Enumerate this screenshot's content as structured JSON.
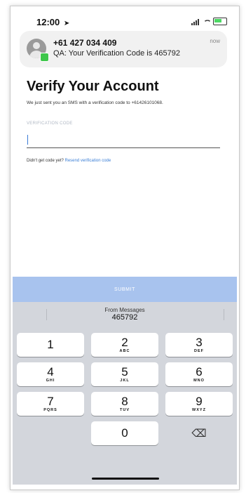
{
  "status_bar": {
    "time": "12:00",
    "nav_arrow": "➤"
  },
  "notification": {
    "sender": "+61 427 034 409",
    "message": "QA: Your Verification Code is 465792",
    "time": "now"
  },
  "page": {
    "title": "Verify Your Account",
    "description": "We just sent you an SMS with a verification code to +61426101068."
  },
  "form": {
    "field_label": "VERIFICATION CODE",
    "field_value": "",
    "resend_prompt": "Didn't get code yet? ",
    "resend_link": "Resend verification code",
    "submit_label": "SUBMIT"
  },
  "keyboard": {
    "suggestion_from": "From Messages",
    "suggestion_code": "465792",
    "keys": [
      {
        "num": "1",
        "letters": ""
      },
      {
        "num": "2",
        "letters": "ABC"
      },
      {
        "num": "3",
        "letters": "DEF"
      },
      {
        "num": "4",
        "letters": "GHI"
      },
      {
        "num": "5",
        "letters": "JKL"
      },
      {
        "num": "6",
        "letters": "MNO"
      },
      {
        "num": "7",
        "letters": "PQRS"
      },
      {
        "num": "8",
        "letters": "TUV"
      },
      {
        "num": "9",
        "letters": "WXYZ"
      },
      {
        "num": "0",
        "letters": ""
      }
    ],
    "delete_icon": "⌫"
  },
  "colors": {
    "submit_bg": "#a8c3ee",
    "link": "#3b7fd6",
    "keyboard_bg": "#d3d6dc"
  }
}
